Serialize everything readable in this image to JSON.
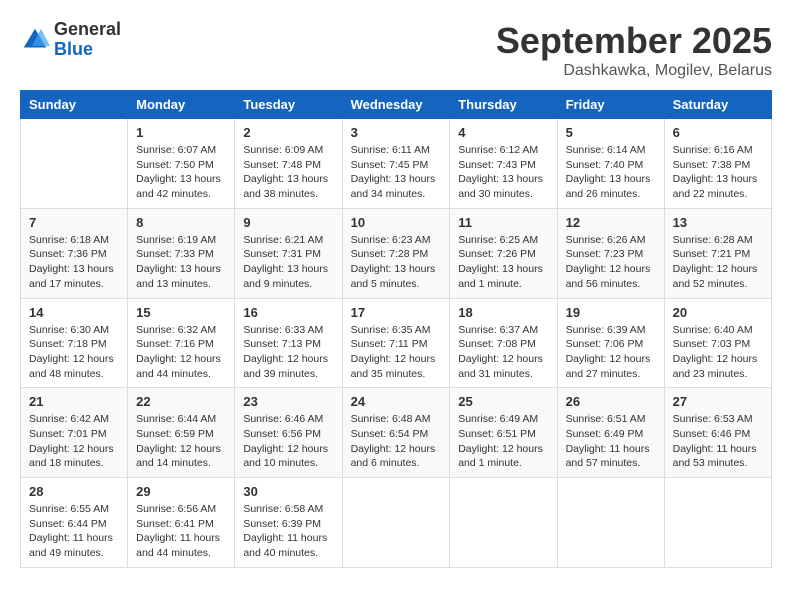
{
  "logo": {
    "general": "General",
    "blue": "Blue"
  },
  "title": {
    "month": "September 2025",
    "location": "Dashkawka, Mogilev, Belarus"
  },
  "weekdays": [
    "Sunday",
    "Monday",
    "Tuesday",
    "Wednesday",
    "Thursday",
    "Friday",
    "Saturday"
  ],
  "weeks": [
    [
      {
        "day": "",
        "info": ""
      },
      {
        "day": "1",
        "info": "Sunrise: 6:07 AM\nSunset: 7:50 PM\nDaylight: 13 hours\nand 42 minutes."
      },
      {
        "day": "2",
        "info": "Sunrise: 6:09 AM\nSunset: 7:48 PM\nDaylight: 13 hours\nand 38 minutes."
      },
      {
        "day": "3",
        "info": "Sunrise: 6:11 AM\nSunset: 7:45 PM\nDaylight: 13 hours\nand 34 minutes."
      },
      {
        "day": "4",
        "info": "Sunrise: 6:12 AM\nSunset: 7:43 PM\nDaylight: 13 hours\nand 30 minutes."
      },
      {
        "day": "5",
        "info": "Sunrise: 6:14 AM\nSunset: 7:40 PM\nDaylight: 13 hours\nand 26 minutes."
      },
      {
        "day": "6",
        "info": "Sunrise: 6:16 AM\nSunset: 7:38 PM\nDaylight: 13 hours\nand 22 minutes."
      }
    ],
    [
      {
        "day": "7",
        "info": "Sunrise: 6:18 AM\nSunset: 7:36 PM\nDaylight: 13 hours\nand 17 minutes."
      },
      {
        "day": "8",
        "info": "Sunrise: 6:19 AM\nSunset: 7:33 PM\nDaylight: 13 hours\nand 13 minutes."
      },
      {
        "day": "9",
        "info": "Sunrise: 6:21 AM\nSunset: 7:31 PM\nDaylight: 13 hours\nand 9 minutes."
      },
      {
        "day": "10",
        "info": "Sunrise: 6:23 AM\nSunset: 7:28 PM\nDaylight: 13 hours\nand 5 minutes."
      },
      {
        "day": "11",
        "info": "Sunrise: 6:25 AM\nSunset: 7:26 PM\nDaylight: 13 hours\nand 1 minute."
      },
      {
        "day": "12",
        "info": "Sunrise: 6:26 AM\nSunset: 7:23 PM\nDaylight: 12 hours\nand 56 minutes."
      },
      {
        "day": "13",
        "info": "Sunrise: 6:28 AM\nSunset: 7:21 PM\nDaylight: 12 hours\nand 52 minutes."
      }
    ],
    [
      {
        "day": "14",
        "info": "Sunrise: 6:30 AM\nSunset: 7:18 PM\nDaylight: 12 hours\nand 48 minutes."
      },
      {
        "day": "15",
        "info": "Sunrise: 6:32 AM\nSunset: 7:16 PM\nDaylight: 12 hours\nand 44 minutes."
      },
      {
        "day": "16",
        "info": "Sunrise: 6:33 AM\nSunset: 7:13 PM\nDaylight: 12 hours\nand 39 minutes."
      },
      {
        "day": "17",
        "info": "Sunrise: 6:35 AM\nSunset: 7:11 PM\nDaylight: 12 hours\nand 35 minutes."
      },
      {
        "day": "18",
        "info": "Sunrise: 6:37 AM\nSunset: 7:08 PM\nDaylight: 12 hours\nand 31 minutes."
      },
      {
        "day": "19",
        "info": "Sunrise: 6:39 AM\nSunset: 7:06 PM\nDaylight: 12 hours\nand 27 minutes."
      },
      {
        "day": "20",
        "info": "Sunrise: 6:40 AM\nSunset: 7:03 PM\nDaylight: 12 hours\nand 23 minutes."
      }
    ],
    [
      {
        "day": "21",
        "info": "Sunrise: 6:42 AM\nSunset: 7:01 PM\nDaylight: 12 hours\nand 18 minutes."
      },
      {
        "day": "22",
        "info": "Sunrise: 6:44 AM\nSunset: 6:59 PM\nDaylight: 12 hours\nand 14 minutes."
      },
      {
        "day": "23",
        "info": "Sunrise: 6:46 AM\nSunset: 6:56 PM\nDaylight: 12 hours\nand 10 minutes."
      },
      {
        "day": "24",
        "info": "Sunrise: 6:48 AM\nSunset: 6:54 PM\nDaylight: 12 hours\nand 6 minutes."
      },
      {
        "day": "25",
        "info": "Sunrise: 6:49 AM\nSunset: 6:51 PM\nDaylight: 12 hours\nand 1 minute."
      },
      {
        "day": "26",
        "info": "Sunrise: 6:51 AM\nSunset: 6:49 PM\nDaylight: 11 hours\nand 57 minutes."
      },
      {
        "day": "27",
        "info": "Sunrise: 6:53 AM\nSunset: 6:46 PM\nDaylight: 11 hours\nand 53 minutes."
      }
    ],
    [
      {
        "day": "28",
        "info": "Sunrise: 6:55 AM\nSunset: 6:44 PM\nDaylight: 11 hours\nand 49 minutes."
      },
      {
        "day": "29",
        "info": "Sunrise: 6:56 AM\nSunset: 6:41 PM\nDaylight: 11 hours\nand 44 minutes."
      },
      {
        "day": "30",
        "info": "Sunrise: 6:58 AM\nSunset: 6:39 PM\nDaylight: 11 hours\nand 40 minutes."
      },
      {
        "day": "",
        "info": ""
      },
      {
        "day": "",
        "info": ""
      },
      {
        "day": "",
        "info": ""
      },
      {
        "day": "",
        "info": ""
      }
    ]
  ]
}
